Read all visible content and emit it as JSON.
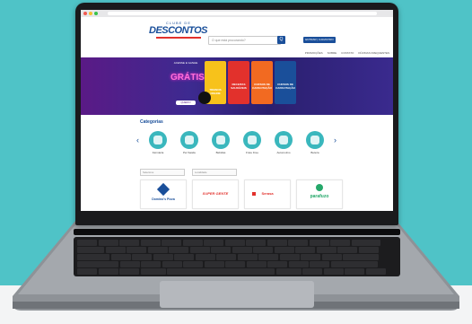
{
  "site": {
    "logo_top": "CLUBE DE",
    "logo_text": "DESCONTOS",
    "search_placeholder": "O que está procurando?",
    "search_button": "Q",
    "login_button": "ENTRAR | CADASTRO",
    "nav": [
      "PROMOÇÕES",
      "SOBRE",
      "CONTATO",
      "DÚVIDAS FREQUENTES"
    ]
  },
  "banner": {
    "small_text": "ACESSE E GANHE",
    "big_text": "GRÁTIS",
    "button": "QUERO!",
    "tiles": [
      {
        "label": "TREINOS ONLINE",
        "color": "#f7c21b"
      },
      {
        "label": "RECEITAS SAUDÁVEIS",
        "color": "#e2312c"
      },
      {
        "label": "CURSOS DE CAPACITAÇÃO",
        "color": "#f26a21"
      },
      {
        "label": "CURSOS DE CAPACITAÇÃO",
        "color": "#1a4f9a"
      }
    ]
  },
  "categories": {
    "title": "Categorias",
    "items": [
      {
        "label": "Farmácia"
      },
      {
        "label": "Pet Saúde"
      },
      {
        "label": "Bebidas"
      },
      {
        "label": "Frete Free"
      },
      {
        "label": "Automotivo"
      },
      {
        "label": "Beleza"
      }
    ]
  },
  "filters": {
    "one": "Selecione",
    "two": "Localidade"
  },
  "stores": [
    {
      "name": "Domino's Pizza",
      "color": "#1a4f9a"
    },
    {
      "name": "SUPER GENTE",
      "color": "#e2312c"
    },
    {
      "name": "Serasa",
      "color": "#e2312c"
    },
    {
      "name": "parafuzo",
      "color": "#25a86a"
    }
  ]
}
